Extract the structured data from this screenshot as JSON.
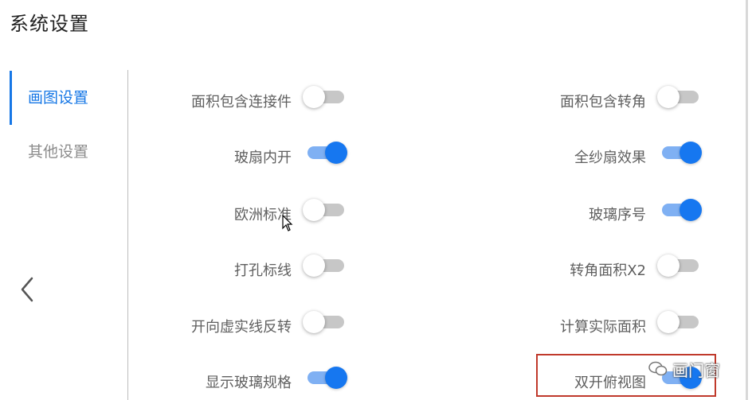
{
  "page": {
    "title": "系统设置"
  },
  "sidebar": {
    "items": [
      {
        "label": "画图设置",
        "active": true
      },
      {
        "label": "其他设置",
        "active": false
      }
    ]
  },
  "settings": {
    "left": [
      {
        "label": "面积包含连接件",
        "on": false
      },
      {
        "label": "玻扇内开",
        "on": true
      },
      {
        "label": "欧洲标准",
        "on": false
      },
      {
        "label": "打孔标线",
        "on": false
      },
      {
        "label": "开向虚实线反转",
        "on": false
      },
      {
        "label": "显示玻璃规格",
        "on": true
      }
    ],
    "right": [
      {
        "label": "面积包含转角",
        "on": false
      },
      {
        "label": "全纱扇效果",
        "on": true
      },
      {
        "label": "玻璃序号",
        "on": true
      },
      {
        "label": "转角面积X2",
        "on": false
      },
      {
        "label": "计算实际面积",
        "on": false
      },
      {
        "label": "双开俯视图",
        "on": true
      }
    ]
  },
  "watermark": {
    "text": "画门窗"
  },
  "colors": {
    "accent": "#1677e6",
    "toggle_on": "#1677f0",
    "toggle_track_on": "#7fb0f3",
    "toggle_off": "#c7c7c7",
    "highlight": "#c0392b"
  }
}
